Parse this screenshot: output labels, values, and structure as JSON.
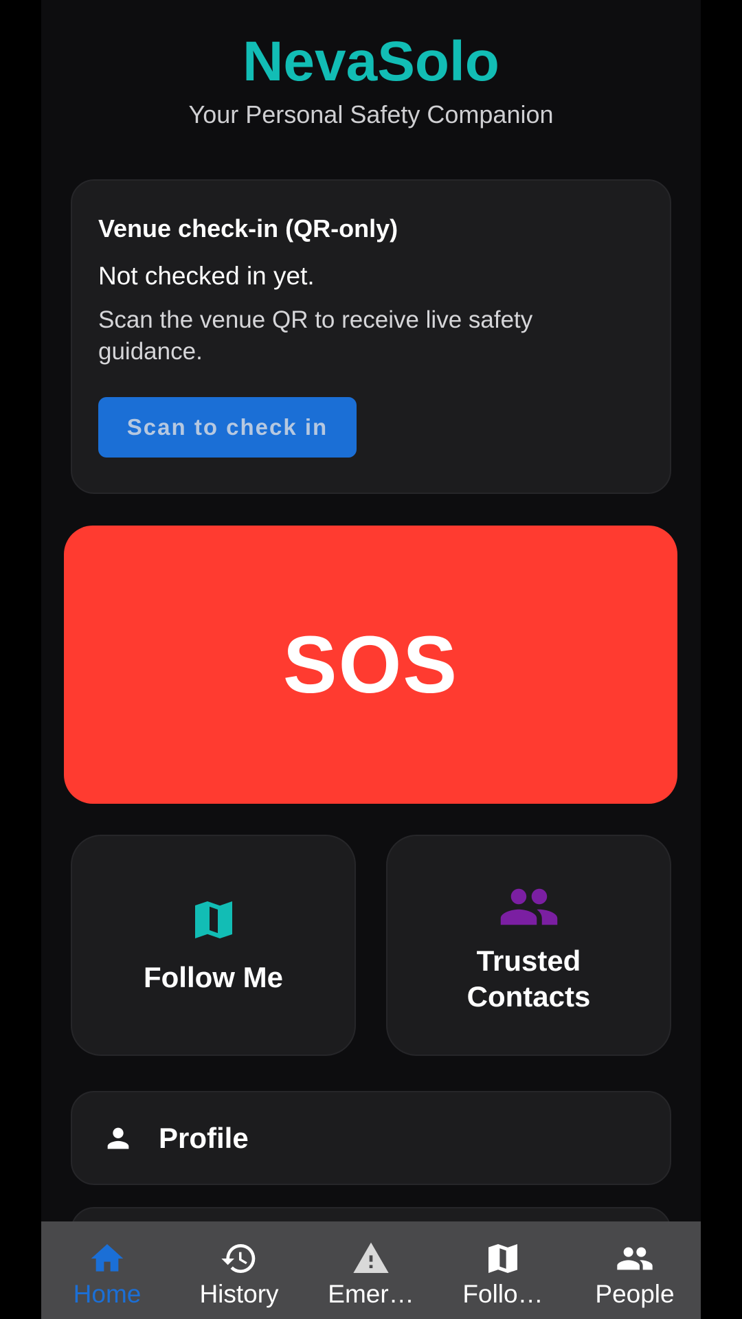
{
  "app": {
    "title": "NevaSolo",
    "subtitle": "Your Personal Safety Companion"
  },
  "venue_checkin": {
    "heading": "Venue check-in (QR-only)",
    "status": "Not checked in yet.",
    "hint": "Scan the venue QR to receive live safety guidance.",
    "button_label": "Scan to check in"
  },
  "sos": {
    "label": "SOS"
  },
  "tiles": [
    {
      "label": "Follow Me",
      "icon": "map-icon"
    },
    {
      "label": "Trusted Contacts",
      "icon": "group-icon"
    }
  ],
  "rows": {
    "profile": {
      "label": "Profile",
      "icon": "person-icon"
    }
  },
  "bottom_nav": [
    {
      "label": "Home",
      "icon": "home-icon",
      "active": true
    },
    {
      "label": "History",
      "icon": "history-icon",
      "active": false
    },
    {
      "label": "Emer…",
      "icon": "warning-icon",
      "active": false
    },
    {
      "label": "Follo…",
      "icon": "map-icon",
      "active": false
    },
    {
      "label": "People",
      "icon": "group-icon",
      "active": false
    }
  ],
  "colors": {
    "brand_teal": "#12bdb5",
    "sos_red": "#ff3b30",
    "primary_blue": "#1b6fd6",
    "contacts_purple": "#7b1fa2",
    "card_bg": "#1c1c1e",
    "nav_bg": "#49494b"
  }
}
